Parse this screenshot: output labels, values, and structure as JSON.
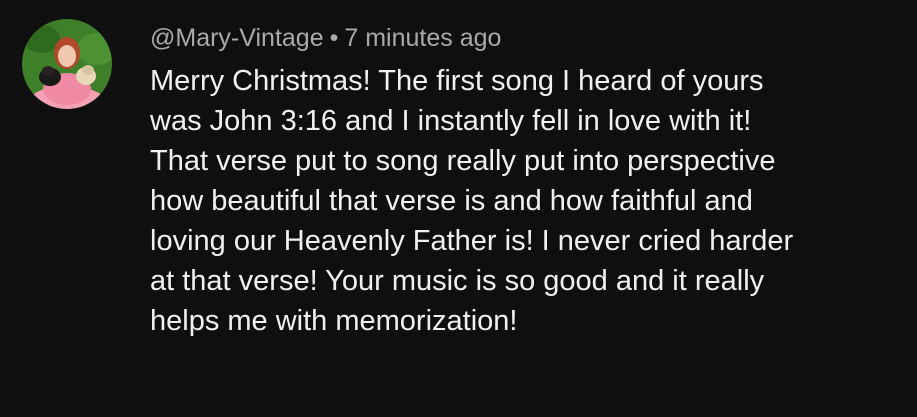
{
  "comment": {
    "author_handle": "@Mary-Vintage",
    "separator": "•",
    "timestamp": "7 minutes ago",
    "text_lines": [
      "Merry Christmas! The first song I heard of yours",
      "was John 3:16 and I instantly fell in love with it!",
      "That verse put to song really put into perspective",
      "how beautiful that verse is and how faithful and",
      "loving our Heavenly Father is! I never cried harder",
      "at that verse! Your music is so good and it really",
      "helps me with memorization!"
    ],
    "avatar": {
      "icon": "profile-photo-avatar",
      "colors": {
        "background": "#3f7f2a",
        "dress": "#f5a0b5",
        "hair": "#b0482a"
      }
    }
  },
  "theme": {
    "background": "#0f0f0f",
    "text": "#f1f1f1",
    "meta": "#aaaaaa"
  }
}
